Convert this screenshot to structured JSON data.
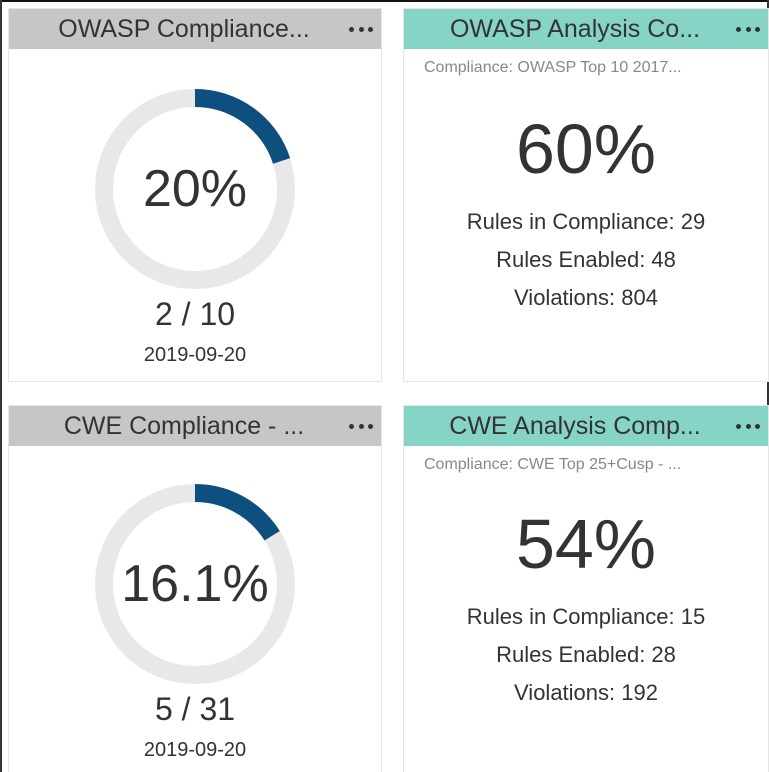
{
  "widgets": {
    "owasp_compliance": {
      "title": "OWASP Compliance...",
      "percent_label": "20%",
      "progress": 0.2,
      "fraction": "2 / 10",
      "date": "2019-09-20"
    },
    "owasp_analysis": {
      "title": "OWASP Analysis Co...",
      "subtitle": "Compliance: OWASP Top 10 2017...",
      "percent_label": "60%",
      "stats": [
        "Rules in Compliance: 29",
        "Rules Enabled: 48",
        "Violations: 804"
      ]
    },
    "cwe_compliance": {
      "title": "CWE Compliance - ...",
      "percent_label": "16.1%",
      "progress": 0.161,
      "fraction": "5 / 31",
      "date": "2019-09-20"
    },
    "cwe_analysis": {
      "title": "CWE Analysis Comp...",
      "subtitle": "Compliance: CWE Top 25+Cusp - ...",
      "percent_label": "54%",
      "stats": [
        "Rules in Compliance: 15",
        "Rules Enabled: 28",
        "Violations: 192"
      ]
    }
  },
  "colors": {
    "header_gray": "#c6c6c6",
    "header_teal": "#86d4c6",
    "donut_track": "#e8e8e8",
    "donut_fill": "#0d4f7e"
  },
  "icons": {
    "menu": "more-options-icon"
  }
}
